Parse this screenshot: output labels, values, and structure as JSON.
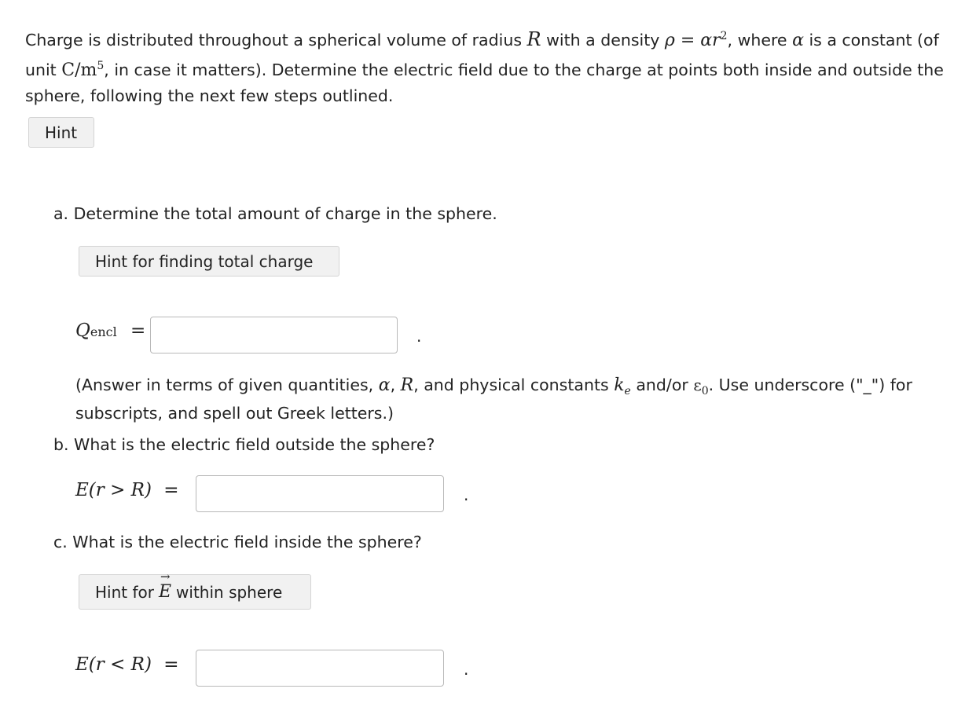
{
  "intro": {
    "t1": "Charge is distributed throughout a spherical volume of radius ",
    "R": "R",
    "t2": " with a density ",
    "rho_eq": "ρ = αr",
    "sq": "2",
    "t3": ", where ",
    "alpha": "α",
    "t4": " is a constant (of unit ",
    "unit": "C/m",
    "five": "5",
    "t5": ", in case it matters). Determine the electric field due to the charge at points both inside and outside the sphere, following the next few steps outlined."
  },
  "hint_button": "Hint",
  "part_a": {
    "question": "a. Determine the total amount of charge in the sphere.",
    "hint_button": "Hint for finding total charge",
    "label_Q": "Q",
    "label_sub": "encl",
    "label_eq": "=",
    "input_value": "",
    "period": ".",
    "note": {
      "t1": "(Answer in terms of given quantities, ",
      "alpha": "α",
      "c1": ", ",
      "R": "R",
      "t2": ", and physical constants ",
      "k": "k",
      "k_sub": "e",
      "t3": " and/or ",
      "eps": "ε",
      "eps_sub": "0",
      "t4": ". Use underscore (\"_\") for subscripts, and spell out Greek letters.)"
    }
  },
  "part_b": {
    "question": "b. What is the electric field outside the sphere?",
    "label": "E(r > R)",
    "label_eq": "=",
    "input_value": "",
    "period": "."
  },
  "part_c": {
    "question": "c. What is the electric field inside the sphere?",
    "hint_pre": "Hint for ",
    "hint_E": "E",
    "hint_post": " within sphere",
    "label": "E(r < R)",
    "label_eq": "=",
    "input_value": "",
    "period": "."
  }
}
